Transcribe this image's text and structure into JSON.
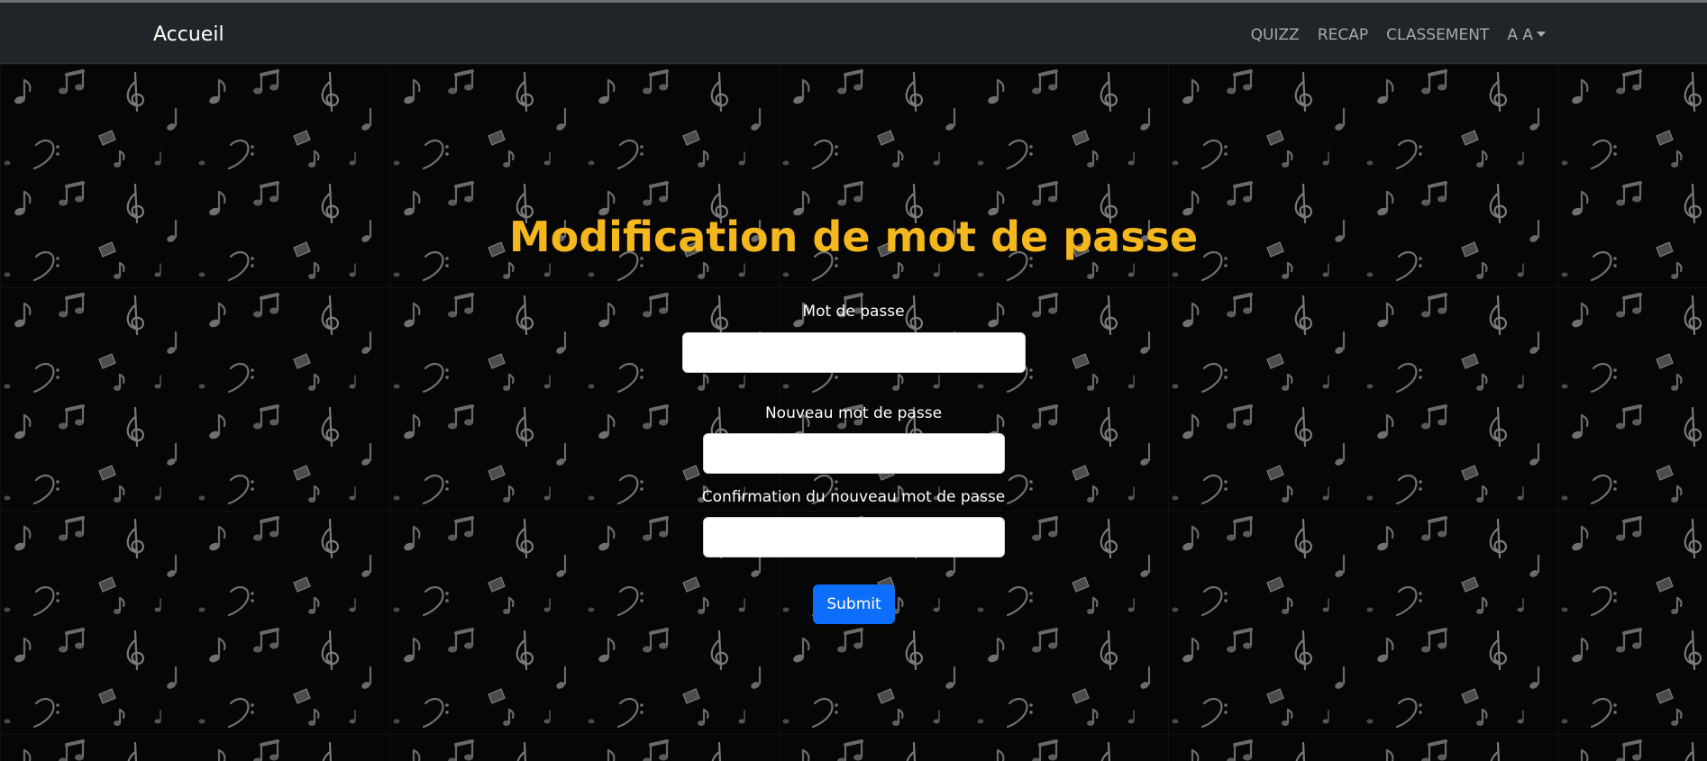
{
  "navbar": {
    "brand": "Accueil",
    "links": [
      {
        "label": "QUIZZ"
      },
      {
        "label": "RECAP"
      },
      {
        "label": "CLASSEMENT"
      }
    ],
    "user_dropdown": "A A",
    "dropdown_icon": "caret-down-icon"
  },
  "background": {
    "pattern": "music-notes-pattern"
  },
  "form": {
    "title": "Modification de mot de passe",
    "current_password_label": "Mot de passe",
    "current_password_value": "",
    "new_password_label": "Nouveau mot de passe",
    "new_password_value": "",
    "confirm_password_label": "Confirmation du nouveau mot de passe",
    "confirm_password_value": "",
    "submit_label": "Submit"
  },
  "colors": {
    "navbar_bg": "#212529",
    "title": "#f4b71c",
    "submit_bg": "#0d6efd",
    "page_bg": "#050505"
  }
}
